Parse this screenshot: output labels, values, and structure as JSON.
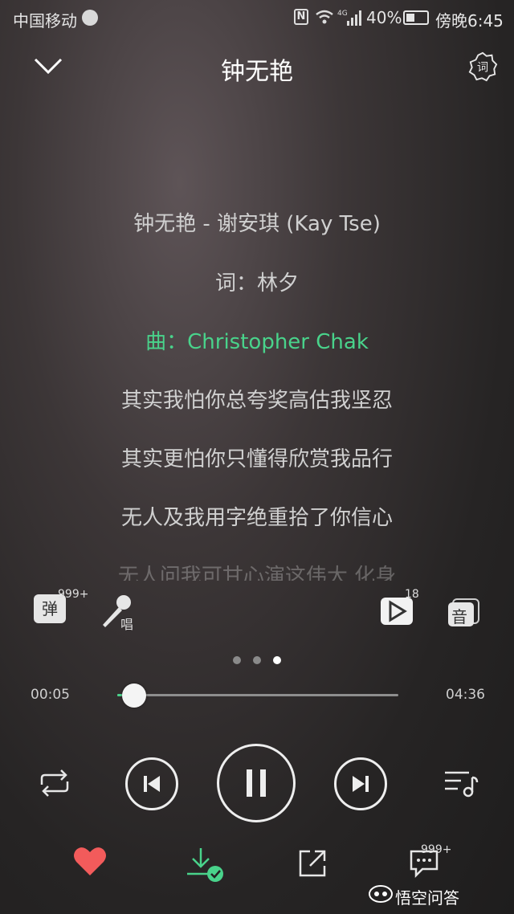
{
  "status_bar": {
    "carrier": "中国移动",
    "network": "4G",
    "battery": "40%",
    "time": "傍晚6:45"
  },
  "header": {
    "title": "钟无艳"
  },
  "lyrics": [
    "钟无艳 - 谢安琪 (Kay Tse)",
    "词：林夕",
    "曲：Christopher Chak",
    "其实我怕你总夸奖高估我坚忍",
    "其实更怕你只懂得欣赏我品行",
    "无人及我用字绝重拾了你信心",
    "无人问我可甘心演这伟大 化身"
  ],
  "active_lyric_index": 2,
  "actions": {
    "danmaku_label": "弹",
    "danmaku_count": "999+",
    "karaoke_label": "唱",
    "video_count": "18",
    "sound_effect_label": "音"
  },
  "pager": {
    "count": 3,
    "current": 2
  },
  "progress": {
    "elapsed": "00:05",
    "duration": "04:36",
    "fraction": 0.018
  },
  "bottom_bar": {
    "comment_count": "999+"
  },
  "watermark": "悟空问答",
  "colors": {
    "accent": "#49d38b",
    "like": "#f25b5b"
  }
}
